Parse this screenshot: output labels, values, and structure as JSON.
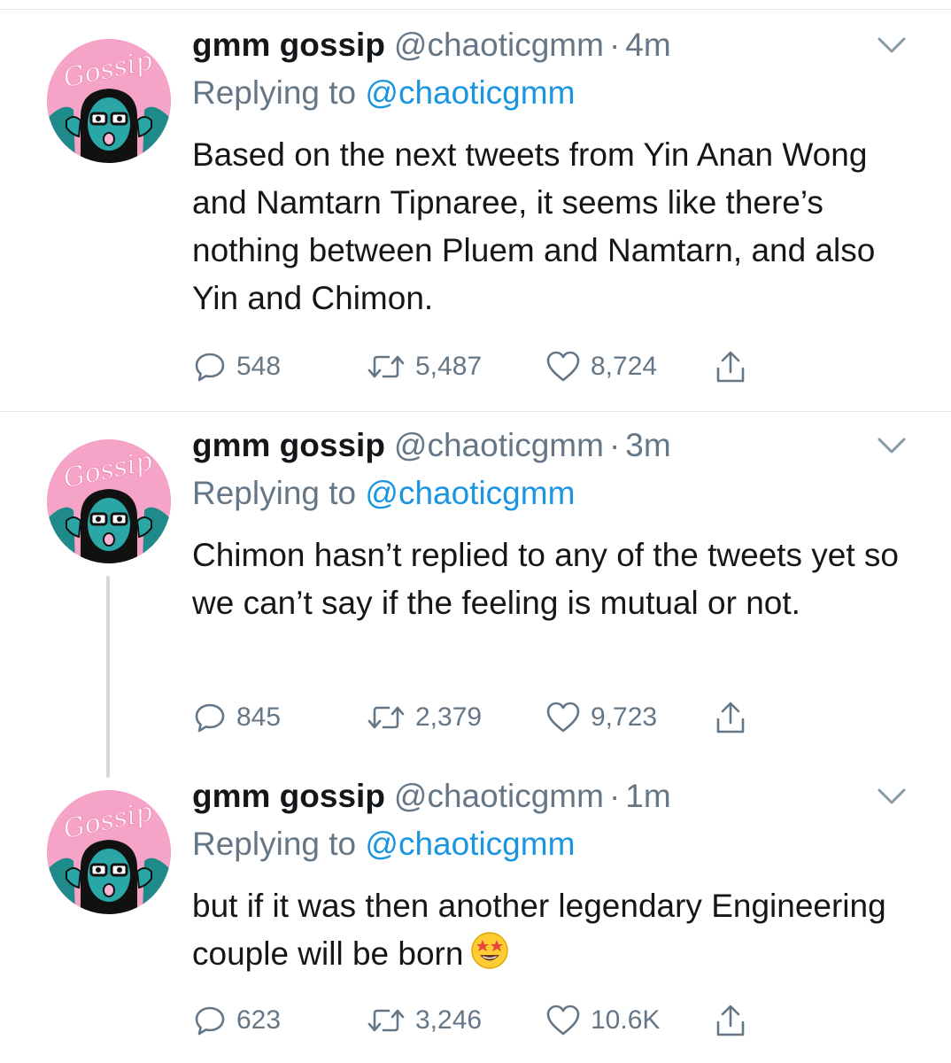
{
  "tweets": [
    {
      "name": "gmm gossip",
      "handle": "@chaoticgmm",
      "dot": "·",
      "time": "4m",
      "replying_prefix": "Replying to",
      "replying_to": "@chaoticgmm",
      "text": "Based on the next tweets from Yin Anan Wong and Namtarn Tipnaree, it seems like there’s nothing between Pluem and Namtarn, and also Yin and Chimon.",
      "replies": "548",
      "retweets": "5,487",
      "likes": "8,724",
      "avatar_text": "Gossip"
    },
    {
      "name": "gmm gossip",
      "handle": "@chaoticgmm",
      "dot": "·",
      "time": "3m",
      "replying_prefix": "Replying to",
      "replying_to": "@chaoticgmm",
      "text": "Chimon hasn’t replied to any of the tweets yet so we can’t say if the feeling is mutual or not.",
      "replies": "845",
      "retweets": "2,379",
      "likes": "9,723",
      "avatar_text": "Gossip"
    },
    {
      "name": "gmm gossip",
      "handle": "@chaoticgmm",
      "dot": "·",
      "time": "1m",
      "replying_prefix": "Replying to",
      "replying_to": "@chaoticgmm",
      "text": "but if it was then another legendary Engineering couple will be born",
      "replies": "623",
      "retweets": "3,246",
      "likes": "10.6K",
      "avatar_text": "Gossip"
    }
  ],
  "colors": {
    "text": "#14171a",
    "secondary": "#657786",
    "link": "#1b95e0",
    "divider": "#e1e8ed",
    "avatar_pink": "#f5a3c7",
    "avatar_teal": "#1e8a8a"
  },
  "icons": [
    "chevron-down-icon",
    "reply-icon",
    "retweet-icon",
    "like-icon",
    "share-icon",
    "star-struck-emoji"
  ]
}
